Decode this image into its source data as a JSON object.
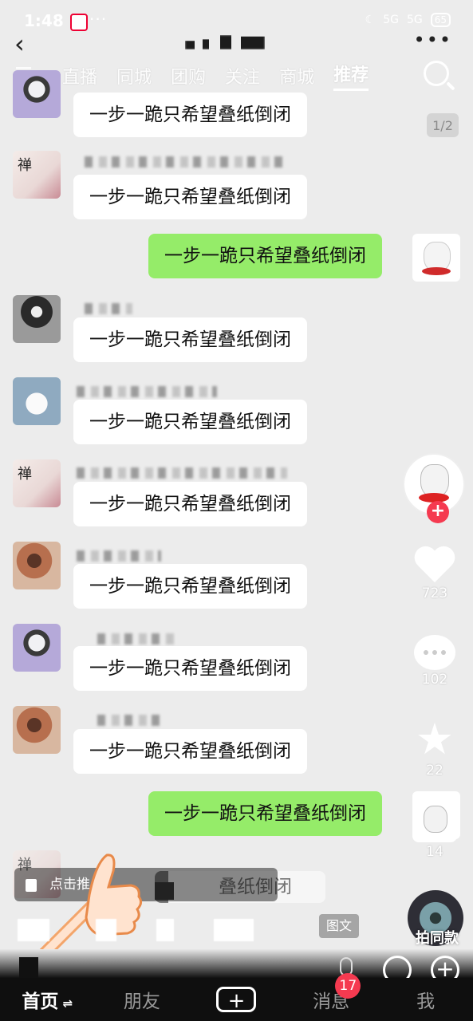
{
  "status": {
    "time": "1:48",
    "app_icon": "app-notification-icon",
    "more_dots": "···",
    "signal_1": "5G",
    "signal_2": "5G",
    "battery": "65"
  },
  "header": {
    "back_icon": "back-arrow-icon",
    "more_icon": "more-icon",
    "title": ""
  },
  "tabs": [
    {
      "label": "直播"
    },
    {
      "label": "同城"
    },
    {
      "label": "团购"
    },
    {
      "label": "关注"
    },
    {
      "label": "商城"
    },
    {
      "label": "推荐",
      "active": true
    }
  ],
  "page_indicator": "1/2",
  "messages": [
    {
      "side": "left",
      "avatar": "purple-flower-avatar",
      "text": "一步一跪只希望叠纸倒闭"
    },
    {
      "side": "left",
      "avatar": "zen-cat-avatar",
      "text": "一步一跪只希望叠纸倒闭"
    },
    {
      "side": "right",
      "avatar": "white-cat-avatar",
      "text": "一步一跪只希望叠纸倒闭"
    },
    {
      "side": "left",
      "avatar": "dark-girl-avatar",
      "text": "一步一跪只希望叠纸倒闭"
    },
    {
      "side": "left",
      "avatar": "bird-avatar",
      "text": "一步一跪只希望叠纸倒闭"
    },
    {
      "side": "left",
      "avatar": "zen-cat-avatar",
      "text": "一步一跪只希望叠纸倒闭"
    },
    {
      "side": "left",
      "avatar": "brown-girl-avatar",
      "text": "一步一跪只希望叠纸倒闭"
    },
    {
      "side": "left",
      "avatar": "purple-flower-avatar",
      "text": "一步一跪只希望叠纸倒闭"
    },
    {
      "side": "left",
      "avatar": "brown-girl-avatar",
      "text": "一步一跪只希望叠纸倒闭"
    },
    {
      "side": "right",
      "avatar": "white-cat-avatar",
      "text": "一步一跪只希望叠纸倒闭"
    }
  ],
  "partial_message_text": "叠纸倒闭",
  "actions": {
    "likes": "723",
    "comments": "102",
    "favorites": "22",
    "shares": "14"
  },
  "bottom": {
    "hint_text": "点击推",
    "tuwen_label": "图文",
    "same_style_label": "拍同款"
  },
  "nav": {
    "home": "首页",
    "friends": "朋友",
    "create": "+",
    "messages": "消息",
    "messages_badge": "17",
    "me": "我"
  }
}
